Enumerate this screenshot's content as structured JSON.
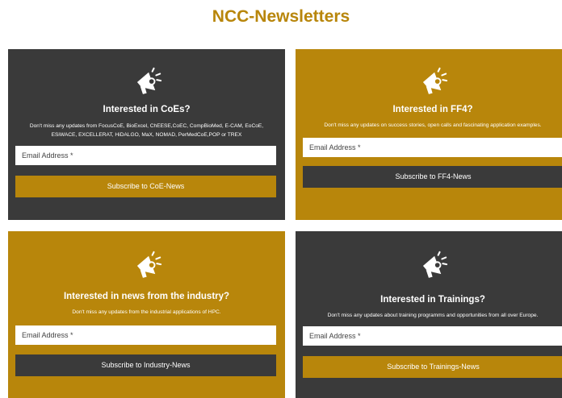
{
  "page": {
    "title": "NCC-Newsletters"
  },
  "colors": {
    "gold": "#b8860b",
    "dark": "#3a3a3a"
  },
  "icon": "megaphone-icon",
  "cards": [
    {
      "heading": "Interested in CoEs?",
      "description": "Don't miss any updates from FocusCoE, BioExcel, ChEESE,CoEC, CompBioMed, E-CAM, EoCoE, ESiWACE, EXCELLERAT, HiDALGO, MaX, NOMAD, PerMedCoE,POP or TREX",
      "email_placeholder": "Email Address *",
      "button_label": "Subscribe to CoE-News"
    },
    {
      "heading": "Interested in FF4?",
      "description": "Don't miss any updates on success stories, open calls and fascinating application examples.",
      "email_placeholder": "Email Address *",
      "button_label": "Subscribe to FF4-News"
    },
    {
      "heading": "Interested in news from the industry?",
      "description": "Don't miss any updates from the industrial applications of HPC.",
      "email_placeholder": "Email Address *",
      "button_label": "Subscribe to Industry-News"
    },
    {
      "heading": "Interested in Trainings?",
      "description": "Don't miss any updates about training programms and opportunities from all over Europe.",
      "email_placeholder": "Email Address *",
      "button_label": "Subscribe to Trainings-News"
    }
  ]
}
